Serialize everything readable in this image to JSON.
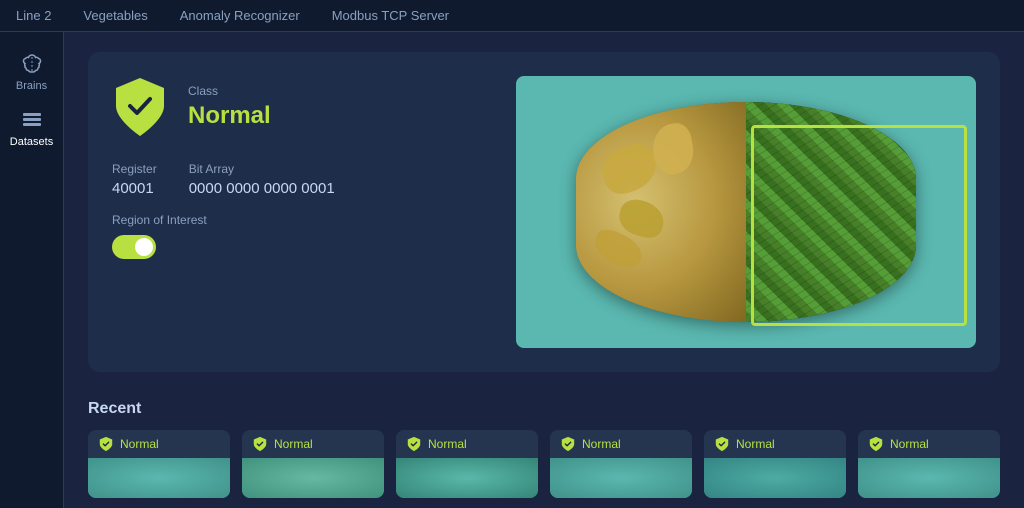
{
  "topbar": {
    "items": [
      "Line 2",
      "Vegetables",
      "Anomaly Recognizer",
      "Modbus TCP Server"
    ]
  },
  "sidebar": {
    "brains_label": "Brains",
    "datasets_label": "Datasets"
  },
  "main": {
    "class_label": "Class",
    "class_value": "Normal",
    "register_label": "Register",
    "register_value": "40001",
    "bit_array_label": "Bit Array",
    "bit_array_value": "0000 0000 0000 0001",
    "roi_label": "Region of Interest"
  },
  "recent": {
    "title": "Recent",
    "items": [
      {
        "label": "Normal"
      },
      {
        "label": "Normal"
      },
      {
        "label": "Normal"
      },
      {
        "label": "Normal"
      },
      {
        "label": "Normal"
      },
      {
        "label": "Normal"
      }
    ]
  },
  "colors": {
    "accent": "#b8e040",
    "bg_dark": "#0f1a2e",
    "bg_medium": "#1e2d4a",
    "text_muted": "#8aa0c0"
  }
}
